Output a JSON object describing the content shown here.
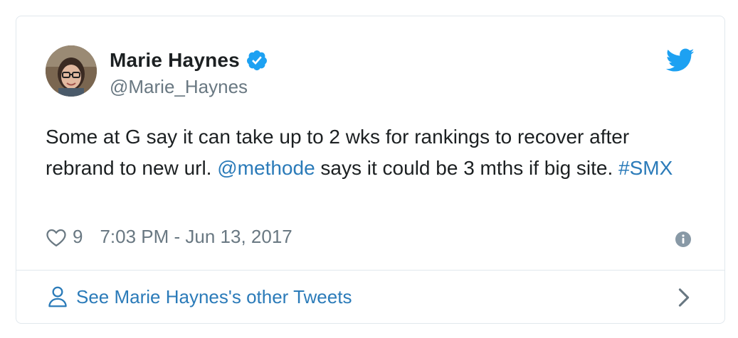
{
  "tweet": {
    "author_name": "Marie Haynes",
    "author_handle": "@Marie_Haynes",
    "text_parts": [
      "Some at G say it can take up to 2 wks for rankings to recover after rebrand to new url. ",
      "@methode",
      " says it could be 3 mths if big site. ",
      "#SMX"
    ],
    "likes": "9",
    "timestamp": "7:03 PM - Jun 13, 2017",
    "verified": true
  },
  "footer": {
    "label": "See Marie Haynes's other Tweets"
  },
  "colors": {
    "link": "#2b7bb9",
    "twitter_blue": "#1da1f2",
    "muted": "#697882",
    "border": "#e1e8ed"
  },
  "icons": [
    "verified-badge-icon",
    "twitter-bird-icon",
    "heart-icon",
    "info-icon",
    "person-icon",
    "chevron-right-icon"
  ]
}
